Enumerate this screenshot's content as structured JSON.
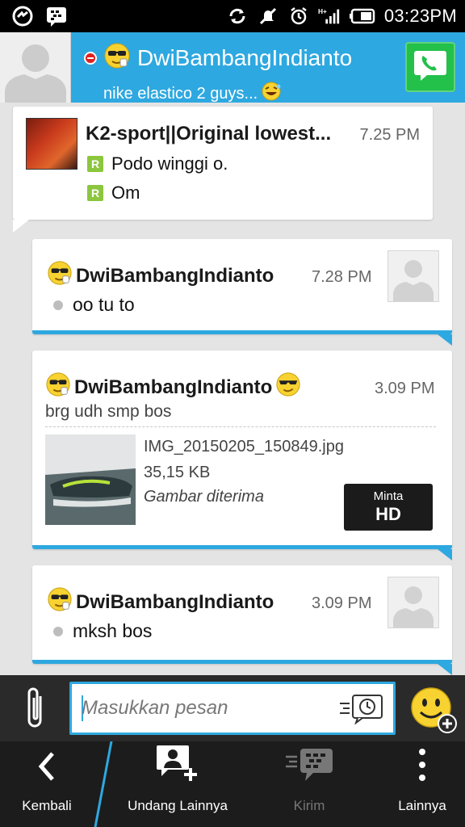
{
  "status_bar": {
    "time": "03:23PM",
    "icons": [
      "app-icon",
      "bbm-icon",
      "sync-icon",
      "mute-icon",
      "alarm-icon",
      "signal-icon",
      "battery-icon"
    ]
  },
  "header": {
    "contact_name": "DwiBambangIndianto",
    "status_message": "nike elastico 2 guys...",
    "status_color": "#e02020",
    "accent": "#2ea8e0"
  },
  "messages": [
    {
      "sender": "K2-sport||Original lowest...",
      "time": "7.25 PM",
      "lines": [
        "Podo winggi o.",
        "Om"
      ]
    },
    {
      "sender": "DwiBambangIndianto",
      "time": "7.28 PM",
      "text": "oo tu to"
    },
    {
      "sender": "DwiBambangIndianto",
      "time": "3.09 PM",
      "text": "brg udh smp bos",
      "attachment": {
        "filename": "IMG_20150205_150849.jpg",
        "size": "35,15 KB",
        "status": "Gambar diterima",
        "button_small": "Minta",
        "button_big": "HD"
      }
    },
    {
      "sender": "DwiBambangIndianto",
      "time": "3.09 PM",
      "text": "mksh bos"
    }
  ],
  "composer": {
    "placeholder": "Masukkan pesan",
    "value": ""
  },
  "nav": {
    "back": "Kembali",
    "invite": "Undang Lainnya",
    "send": "Kirim",
    "more": "Lainnya"
  }
}
